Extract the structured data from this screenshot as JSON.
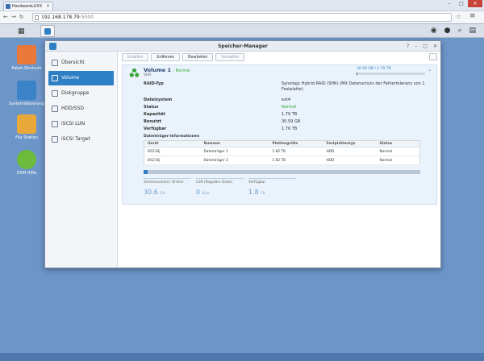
{
  "browser": {
    "tab_title": "HardwareLUXX",
    "url_host": "192.168.178.79",
    "url_port": ":5000"
  },
  "desktop": {
    "icons": [
      {
        "label": "Paket-Zentrum",
        "color": "#e8793a"
      },
      {
        "label": "Systemsteuerung",
        "color": "#3a83c9"
      },
      {
        "label": "File Station",
        "color": "#e8a93a"
      },
      {
        "label": "DSM Hilfe",
        "color": "#6dbb3c"
      }
    ]
  },
  "window": {
    "title": "Speicher-Manager",
    "sidebar": [
      {
        "label": "Übersicht"
      },
      {
        "label": "Volume"
      },
      {
        "label": "Diskgruppe"
      },
      {
        "label": "HDD/SSD"
      },
      {
        "label": "iSCSI LUN"
      },
      {
        "label": "iSCSI Target"
      }
    ],
    "active_index": 1,
    "toolbar": {
      "create": "Erstellen",
      "remove": "Entfernen",
      "edit": "Bearbeiten",
      "manage": "Verwalten"
    },
    "volume": {
      "name": "Volume 1",
      "status_dash": "- Normal",
      "sub": "SHR",
      "usage_text": "30.59 GB / 1.79 TB",
      "usage_fraction": 0.017,
      "props": [
        {
          "key": "RAID-Typ",
          "value": "Synology Hybrid RAID (SHR) (Mit Datenschutz der Fehlertoleranz von 1 Festplatte)"
        },
        {
          "key": "Dateisystem",
          "value": "ext4"
        },
        {
          "key": "Status",
          "value": "Normal"
        },
        {
          "key": "Kapazität",
          "value": "1.79 TB"
        },
        {
          "key": "Benutzt",
          "value": "30.59 GB"
        },
        {
          "key": "Verfügbar",
          "value": "1.76 TB"
        }
      ],
      "disk_section_title": "Datenträger-Informationen",
      "disk_headers": [
        "Gerät",
        "Nummer",
        "Plattengröße",
        "Festplattentyp",
        "Status"
      ],
      "disks": [
        [
          "DS216j",
          "Datenträger 1",
          "1.82 TB",
          "HDD",
          "Normal"
        ],
        [
          "DS216j",
          "Datenträger 2",
          "1.82 TB",
          "HDD",
          "Normal"
        ]
      ],
      "stats": [
        {
          "label": "Gemeinsame(r) Ordner",
          "value": "30.6",
          "unit": "GB"
        },
        {
          "label": "LUN (Reguläre Datei)",
          "value": "0",
          "unit": "Byte"
        },
        {
          "label": "Verfügbar",
          "value": "1.8",
          "unit": "TB"
        }
      ]
    }
  }
}
